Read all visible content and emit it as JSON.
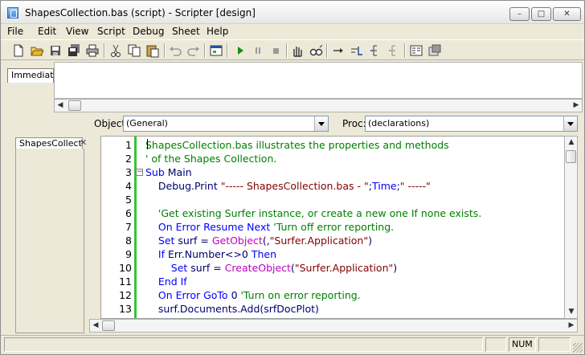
{
  "window": {
    "title": "ShapesCollection.bas (script) - Scripter [design]",
    "controls": {
      "minimize": "–",
      "maximize": "□",
      "close": "✕"
    }
  },
  "menu": [
    "File",
    "Edit",
    "View",
    "Script",
    "Debug",
    "Sheet",
    "Help"
  ],
  "toolbar": {
    "icons": [
      "new-icon",
      "open-icon",
      "save-icon",
      "save-all-icon",
      "print-icon",
      "cut-icon",
      "copy-icon",
      "paste-icon",
      "undo-icon",
      "redo-icon",
      "dialog-editor-icon",
      "run-icon",
      "pause-icon",
      "stop-icon",
      "hand-icon",
      "quick-watch-icon",
      "step-into-icon",
      "step-over-icon",
      "step-out-icon",
      "toggle-breakpoint-icon",
      "object-browser-icon",
      "references-icon"
    ]
  },
  "immediate": {
    "tab_label": "Immediate",
    "content": ""
  },
  "object_selector": {
    "label": "Object:",
    "value": "(General)"
  },
  "proc_selector": {
    "label": "Proc:",
    "value": "(declarations)"
  },
  "file_tab": {
    "label": "ShapesCollection.bas",
    "close": "✕"
  },
  "code": {
    "lines": [
      {
        "num": "1",
        "segments": [
          {
            "t": "ShapesCollection.bas illustrates the properties and methods",
            "c": "comment"
          }
        ]
      },
      {
        "num": "2",
        "segments": [
          {
            "t": "' of the Shapes Collection.",
            "c": "comment"
          }
        ]
      },
      {
        "num": "3",
        "segments": [
          {
            "t": "Sub",
            "c": "kw"
          },
          {
            "t": " Main",
            "c": "txt"
          }
        ]
      },
      {
        "num": "4",
        "segments": [
          {
            "t": "    Debug.Print ",
            "c": "txt"
          },
          {
            "t": "\"----- ShapesCollection.bas - \"",
            "c": "str"
          },
          {
            "t": ";",
            "c": "txt"
          },
          {
            "t": "Time",
            "c": "kw"
          },
          {
            "t": ";",
            "c": "txt"
          },
          {
            "t": "\" -----\"",
            "c": "str"
          }
        ]
      },
      {
        "num": "5",
        "segments": [
          {
            "t": "",
            "c": "txt"
          }
        ]
      },
      {
        "num": "6",
        "segments": [
          {
            "t": "    'Get existing Surfer instance, or create a new one If none exists.",
            "c": "comment"
          }
        ]
      },
      {
        "num": "7",
        "segments": [
          {
            "t": "    On ",
            "c": "kw"
          },
          {
            "t": "Error",
            "c": "kw"
          },
          {
            "t": " Resume Next ",
            "c": "kw"
          },
          {
            "t": "'Turn off error reporting.",
            "c": "comment"
          }
        ]
      },
      {
        "num": "8",
        "segments": [
          {
            "t": "    Set ",
            "c": "kw"
          },
          {
            "t": "surf = ",
            "c": "txt"
          },
          {
            "t": "GetObject",
            "c": "fn"
          },
          {
            "t": "(,",
            "c": "txt"
          },
          {
            "t": "\"Surfer.Application\"",
            "c": "str"
          },
          {
            "t": ")",
            "c": "txt"
          }
        ]
      },
      {
        "num": "9",
        "segments": [
          {
            "t": "    If ",
            "c": "kw"
          },
          {
            "t": "Err.Number<>0 ",
            "c": "txt"
          },
          {
            "t": "Then",
            "c": "kw"
          }
        ]
      },
      {
        "num": "10",
        "segments": [
          {
            "t": "        Set ",
            "c": "kw"
          },
          {
            "t": "surf = ",
            "c": "txt"
          },
          {
            "t": "CreateObject",
            "c": "fn"
          },
          {
            "t": "(",
            "c": "txt"
          },
          {
            "t": "\"Surfer.Application\"",
            "c": "str"
          },
          {
            "t": ")",
            "c": "txt"
          }
        ]
      },
      {
        "num": "11",
        "segments": [
          {
            "t": "    End If",
            "c": "kw"
          }
        ]
      },
      {
        "num": "12",
        "segments": [
          {
            "t": "    On ",
            "c": "kw"
          },
          {
            "t": "Error",
            "c": "kw"
          },
          {
            "t": " GoTo ",
            "c": "kw"
          },
          {
            "t": "0 ",
            "c": "txt"
          },
          {
            "t": "'Turn on error reporting.",
            "c": "comment"
          }
        ]
      },
      {
        "num": "13",
        "segments": [
          {
            "t": "    surf.Documents.Add(srfDocPlot)",
            "c": "txt"
          }
        ]
      }
    ]
  },
  "status": {
    "panel_num": "NUM"
  },
  "colors": {
    "comment": "#008000",
    "keyword": "#0000ff",
    "string": "#800000",
    "function": "#c000c0",
    "breakpoint_bar": "#36c436"
  }
}
